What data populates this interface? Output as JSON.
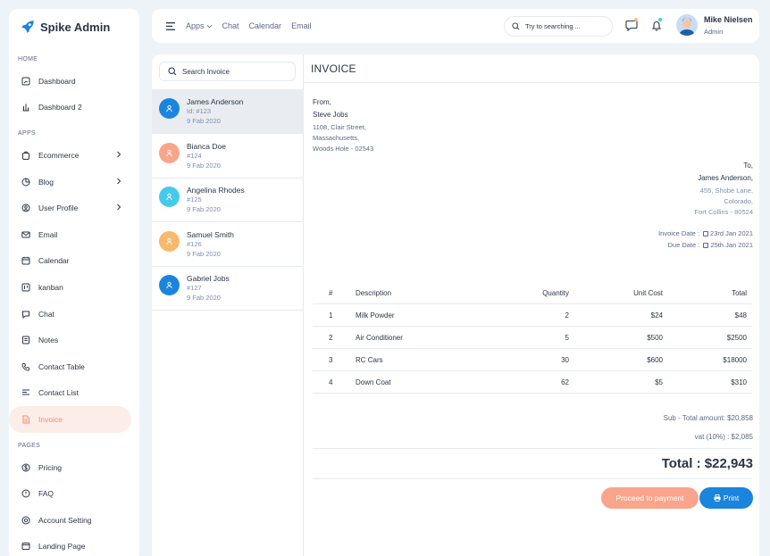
{
  "brand": {
    "name": "Spike Admin"
  },
  "sidebar": {
    "sections": {
      "home": "HOME",
      "apps": "APPS",
      "pages": "PAGES"
    },
    "home_items": [
      {
        "label": "Dashboard",
        "icon": "dashboard-icon"
      },
      {
        "label": "Dashboard 2",
        "icon": "chart-bar-icon"
      }
    ],
    "apps_items": [
      {
        "label": "Ecommerce",
        "icon": "bag-icon"
      },
      {
        "label": "Blog",
        "icon": "pie-chart-icon"
      },
      {
        "label": "User Profile",
        "icon": "user-circle-icon"
      },
      {
        "label": "Email",
        "icon": "mail-icon"
      },
      {
        "label": "Calendar",
        "icon": "calendar-icon"
      },
      {
        "label": "kanban",
        "icon": "layout-kanban-icon"
      },
      {
        "label": "Chat",
        "icon": "message-icon"
      },
      {
        "label": "Notes",
        "icon": "notes-icon"
      },
      {
        "label": "Contact Table",
        "icon": "phone-icon"
      },
      {
        "label": "Contact List",
        "icon": "list-details-icon"
      },
      {
        "label": "Invoice",
        "icon": "file-text-icon"
      }
    ],
    "pages_items": [
      {
        "label": "Pricing",
        "icon": "currency-icon"
      },
      {
        "label": "FAQ",
        "icon": "help-icon"
      },
      {
        "label": "Account Setting",
        "icon": "user-settings-icon"
      },
      {
        "label": "Landing Page",
        "icon": "app-window-icon"
      }
    ]
  },
  "header": {
    "nav": [
      "Apps",
      "Chat",
      "Calendar",
      "Email"
    ],
    "search_placeholder": "Try to searching ...",
    "user_name": "Mike Nielsen",
    "user_role": "Admin"
  },
  "invoice_list": {
    "search_placeholder": "Search Invoice",
    "items": [
      {
        "name": "James Anderson",
        "id": "Id: #123",
        "date": "9 Fab 2020",
        "color": "#1b84dd"
      },
      {
        "name": "Bianca Doe",
        "id": "#124",
        "date": "9 Fab 2020",
        "color": "#f8a58b"
      },
      {
        "name": "Angelina Rhodes",
        "id": "#125",
        "date": "9 Fab 2020",
        "color": "#46caeb"
      },
      {
        "name": "Samuel Smith",
        "id": "#126",
        "date": "9 Fab 2020",
        "color": "#f7b96b"
      },
      {
        "name": "Gabriel Jobs",
        "id": "#127",
        "date": "9 Fab 2020",
        "color": "#1b84dd"
      }
    ]
  },
  "invoice": {
    "title": "INVOICE",
    "from_label": "From,",
    "from_name": "Steve Jobs",
    "from_address": [
      "1108, Clair Street,",
      "Massachusetts,",
      "Woods Hole - 02543"
    ],
    "to_label": "To,",
    "to_name": "James Anderson,",
    "to_address": [
      "455, Shobe Lane,",
      "Colorado,",
      "Fort Collins - 80524"
    ],
    "invoice_date_label": "Invoice Date :",
    "invoice_date": "23rd Jan 2021",
    "due_date_label": "Due Date :",
    "due_date": "25th Jan 2021",
    "columns": [
      "#",
      "Description",
      "Quantity",
      "Unit Cost",
      "Total"
    ],
    "rows": [
      [
        "1",
        "Milk Powder",
        "2",
        "$24",
        "$48"
      ],
      [
        "2",
        "Air Conditioner",
        "5",
        "$500",
        "$2500"
      ],
      [
        "3",
        "RC Cars",
        "30",
        "$600",
        "$18000"
      ],
      [
        "4",
        "Down Coat",
        "62",
        "$5",
        "$310"
      ]
    ],
    "subtotal": "Sub - Total amount: $20,858",
    "vat": "vat (10%) : $2,085",
    "total": "Total : $22,943",
    "pay_button": "Proceed to payment",
    "print_button": "Print"
  }
}
